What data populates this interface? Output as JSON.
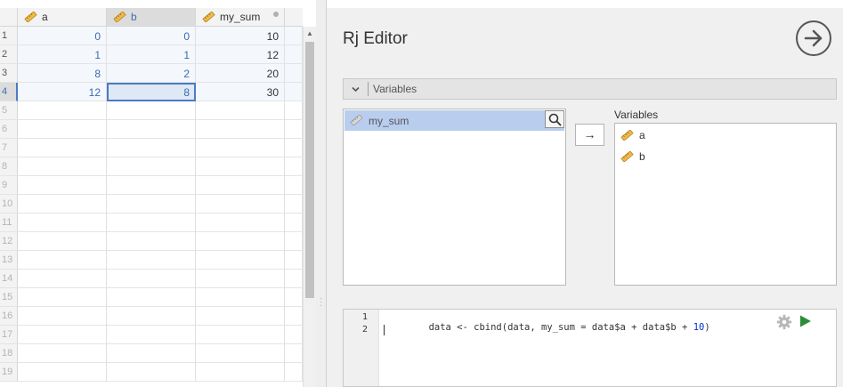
{
  "colors": {
    "accent": "#4a7bc4",
    "selected_item": "#b9cdef",
    "run": "#2e8b3a"
  },
  "spreadsheet": {
    "columns": [
      {
        "name": "a",
        "icon": "ruler-icon"
      },
      {
        "name": "b",
        "icon": "ruler-icon"
      },
      {
        "name": "my_sum",
        "icon": "ruler-icon"
      }
    ],
    "rows": [
      {
        "num": "1",
        "a": "0",
        "b": "0",
        "my_sum": "10"
      },
      {
        "num": "2",
        "a": "1",
        "b": "1",
        "my_sum": "12"
      },
      {
        "num": "3",
        "a": "8",
        "b": "2",
        "my_sum": "20"
      },
      {
        "num": "4",
        "a": "12",
        "b": "8",
        "my_sum": "30"
      },
      {
        "num": "5"
      },
      {
        "num": "6"
      },
      {
        "num": "7"
      },
      {
        "num": "8"
      },
      {
        "num": "9"
      },
      {
        "num": "10"
      },
      {
        "num": "11"
      },
      {
        "num": "12"
      },
      {
        "num": "13"
      },
      {
        "num": "14"
      },
      {
        "num": "15"
      },
      {
        "num": "16"
      },
      {
        "num": "17"
      },
      {
        "num": "18"
      },
      {
        "num": "19"
      }
    ]
  },
  "editor": {
    "title": "Rj Editor",
    "section_label": "Variables",
    "target_item": "my_sum",
    "variables_label": "Variables",
    "variables": [
      "a",
      "b"
    ],
    "arrow_label": "→",
    "code_lines": [
      {
        "num": "1",
        "tokens": [
          {
            "t": "data <- cbind(data, my_sum = data$a + data$b + ",
            "k": "plain"
          },
          {
            "t": "10",
            "k": "num"
          },
          {
            "t": ")",
            "k": "plain"
          }
        ]
      },
      {
        "num": "2",
        "tokens": []
      }
    ]
  }
}
